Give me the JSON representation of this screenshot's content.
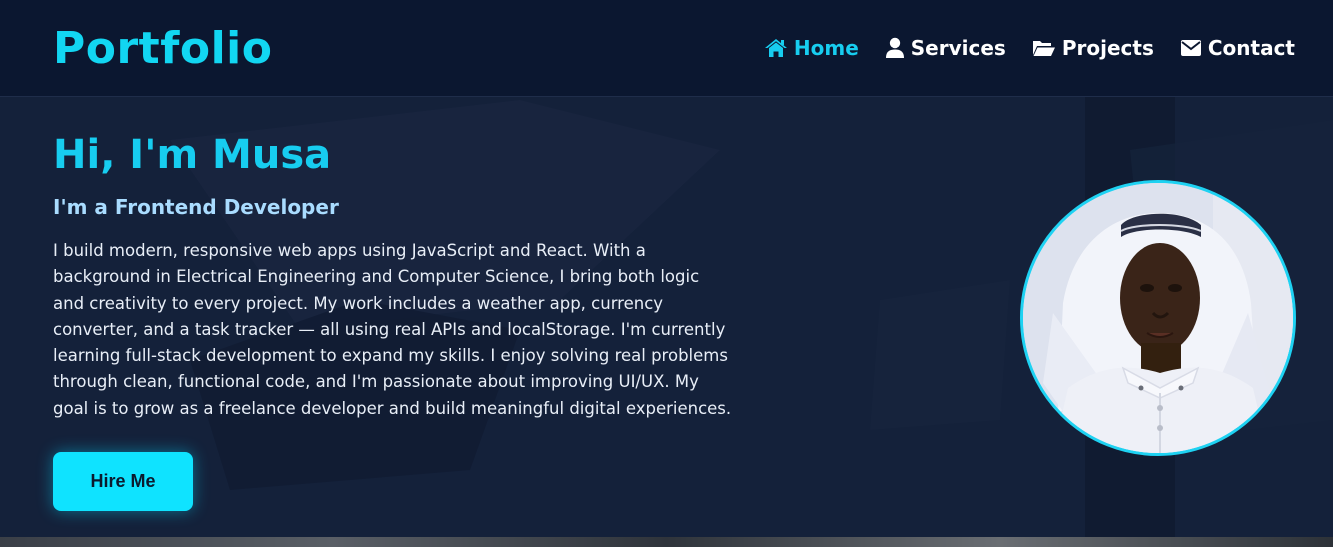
{
  "header": {
    "logo": "Portfolio",
    "nav": [
      {
        "label": "Home",
        "icon": "home-icon",
        "active": true
      },
      {
        "label": "Services",
        "icon": "user-icon",
        "active": false
      },
      {
        "label": "Projects",
        "icon": "folder-open-icon",
        "active": false
      },
      {
        "label": "Contact",
        "icon": "envelope-icon",
        "active": false
      }
    ]
  },
  "hero": {
    "title": "Hi, I'm Musa",
    "subtitle": "I'm a Frontend Developer",
    "bio": "I build modern, responsive web apps using JavaScript and React. With a background in Electrical Engineering and Computer Science, I bring both logic and creativity to every project. My work includes a weather app, currency converter, and a task tracker — all using real APIs and localStorage. I'm currently learning full-stack development to expand my skills. I enjoy solving real problems through clean, functional code, and I'm passionate about improving UI/UX. My goal is to grow as a freelance developer and build meaningful digital experiences.",
    "cta_label": "Hire Me",
    "avatar_icon": "profile-photo"
  },
  "colors": {
    "accent": "#17cdf0",
    "button": "#0fe3ff",
    "header_bg": "#0b1730",
    "page_bg": "#14213a",
    "subtitle": "#a9dcff"
  }
}
